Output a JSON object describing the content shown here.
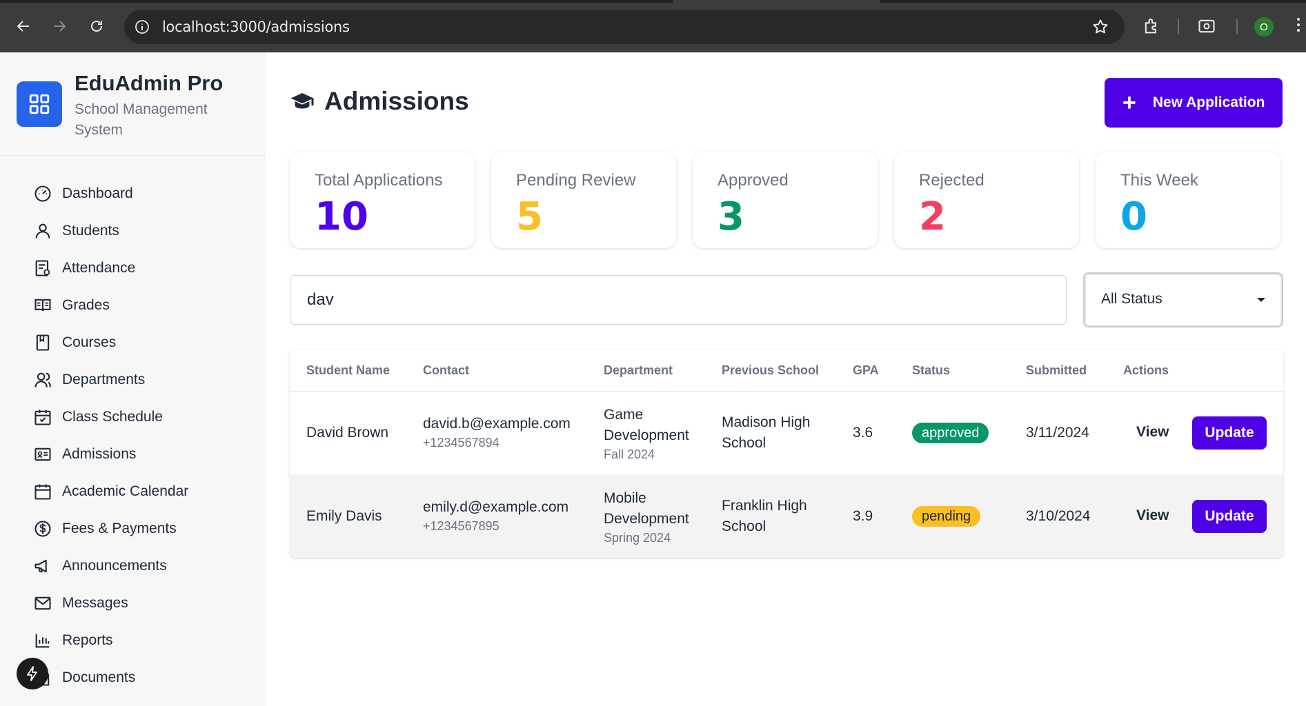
{
  "browser": {
    "url": "localhost:3000/admissions",
    "profile_initial": "O"
  },
  "brand": {
    "title": "EduAdmin Pro",
    "subtitle": "School Management System",
    "color": "#2563eb"
  },
  "sidebar": {
    "items": [
      {
        "label": "Dashboard",
        "icon": "dashboard-icon"
      },
      {
        "label": "Students",
        "icon": "user-icon"
      },
      {
        "label": "Attendance",
        "icon": "attendance-icon"
      },
      {
        "label": "Grades",
        "icon": "book-open-icon"
      },
      {
        "label": "Courses",
        "icon": "bookmark-icon"
      },
      {
        "label": "Departments",
        "icon": "users-icon"
      },
      {
        "label": "Class Schedule",
        "icon": "calendar-check-icon"
      },
      {
        "label": "Admissions",
        "icon": "id-card-icon"
      },
      {
        "label": "Academic Calendar",
        "icon": "calendar-icon"
      },
      {
        "label": "Fees & Payments",
        "icon": "dollar-icon"
      },
      {
        "label": "Announcements",
        "icon": "megaphone-icon"
      },
      {
        "label": "Messages",
        "icon": "mail-icon"
      },
      {
        "label": "Reports",
        "icon": "bar-chart-icon"
      },
      {
        "label": "Documents",
        "icon": "document-icon"
      }
    ]
  },
  "page": {
    "title": "Admissions",
    "new_button": "New Application",
    "accent": "#4f00e6"
  },
  "stats": [
    {
      "label": "Total Applications",
      "value": "10",
      "color": "#4f00e6"
    },
    {
      "label": "Pending Review",
      "value": "5",
      "color": "#fbbf24"
    },
    {
      "label": "Approved",
      "value": "3",
      "color": "#059669"
    },
    {
      "label": "Rejected",
      "value": "2",
      "color": "#f43f5e"
    },
    {
      "label": "This Week",
      "value": "0",
      "color": "#0ea5e9"
    }
  ],
  "filters": {
    "search_value": "dav",
    "status_selected": "All Status"
  },
  "table": {
    "headers": [
      "Student Name",
      "Contact",
      "Department",
      "Previous School",
      "GPA",
      "Status",
      "Submitted",
      "Actions"
    ],
    "rows": [
      {
        "name": "David Brown",
        "email": "david.b@example.com",
        "phone": "+1234567894",
        "department": "Game Development",
        "term": "Fall 2024",
        "previous_school": "Madison High School",
        "gpa": "3.6",
        "status": "approved",
        "submitted": "3/11/2024",
        "view": "View",
        "update": "Update"
      },
      {
        "name": "Emily Davis",
        "email": "emily.d@example.com",
        "phone": "+1234567895",
        "department": "Mobile Development",
        "term": "Spring 2024",
        "previous_school": "Franklin High School",
        "gpa": "3.9",
        "status": "pending",
        "submitted": "3/10/2024",
        "view": "View",
        "update": "Update"
      }
    ]
  }
}
